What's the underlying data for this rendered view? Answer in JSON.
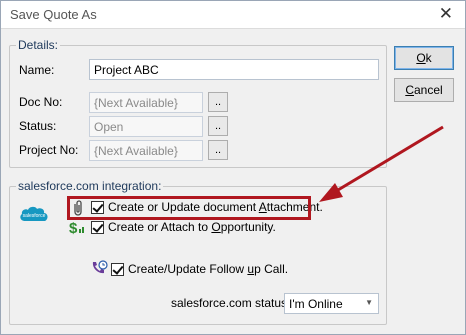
{
  "window": {
    "title": "Save Quote As",
    "close_glyph": "✕"
  },
  "details": {
    "legend": "Details:",
    "name": {
      "label": "Name:",
      "value": "Project ABC"
    },
    "doc_no": {
      "label": "Doc No:",
      "value": "{Next Available}",
      "browse": ".."
    },
    "status": {
      "label": "Status:",
      "value": "Open",
      "browse": ".."
    },
    "project_no": {
      "label": "Project No:",
      "value": "{Next Available}",
      "browse": ".."
    }
  },
  "buttons": {
    "ok": {
      "prefix": "",
      "accel": "O",
      "rest": "k"
    },
    "cancel": {
      "prefix": "",
      "accel": "C",
      "rest": "ancel"
    }
  },
  "integration": {
    "legend": "salesforce.com integration:",
    "logo_text": "salesforce",
    "attachment": {
      "checked": true,
      "label_pre": "Create or Update document ",
      "accel": "A",
      "label_post": "ttachment."
    },
    "opportunity": {
      "checked": true,
      "label_pre": "Create or Attach to ",
      "accel": "O",
      "label_post": "pportunity."
    },
    "followup": {
      "checked": true,
      "label_pre": "Create/Update Follow ",
      "accel": "u",
      "label_post": "p Call."
    },
    "status": {
      "label": "salesforce.com status:",
      "value": "I'm Online"
    }
  },
  "colors": {
    "highlight": "#b0171f",
    "arrow": "#b0171f",
    "salesforce_blue": "#1798c1"
  }
}
